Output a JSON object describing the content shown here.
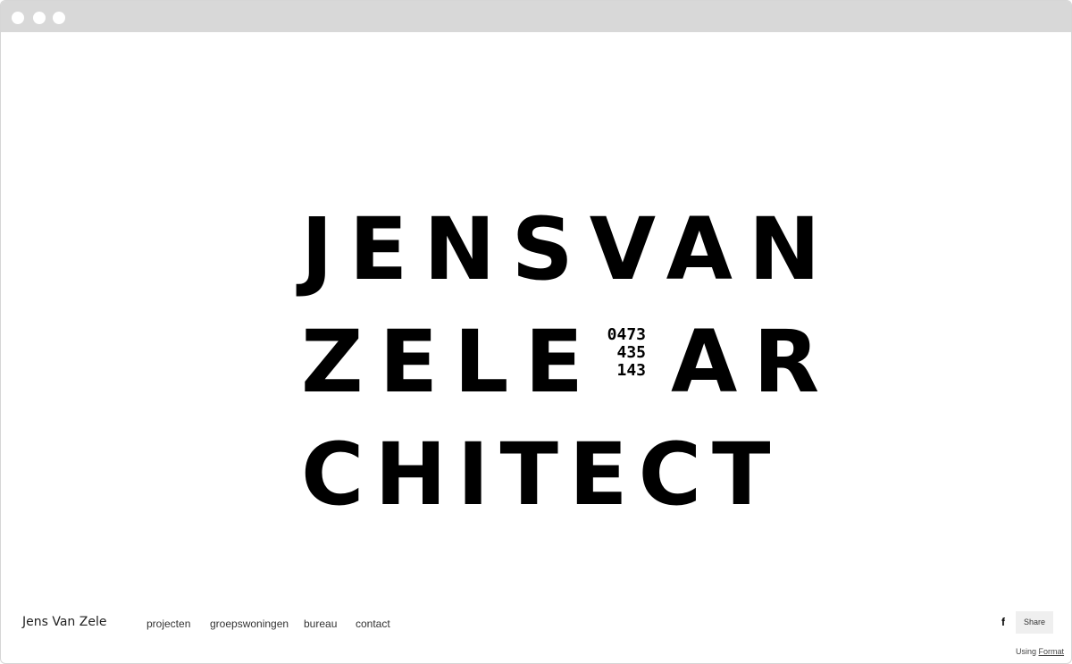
{
  "logo": {
    "line1": "JENSVAN",
    "line2_left": "ZELE",
    "line2_right": "AR",
    "line3": "CHITECT",
    "phone": [
      "0473",
      "435",
      "143"
    ]
  },
  "footer": {
    "site_name": "Jens Van Zele",
    "nav": [
      "projecten",
      "groepswoningen",
      "bureau",
      "contact"
    ],
    "facebook_glyph": "f",
    "share_label": "Share"
  },
  "credit": {
    "prefix": "Using",
    "link": "Format"
  },
  "icons": {
    "facebook": "facebook-icon"
  }
}
